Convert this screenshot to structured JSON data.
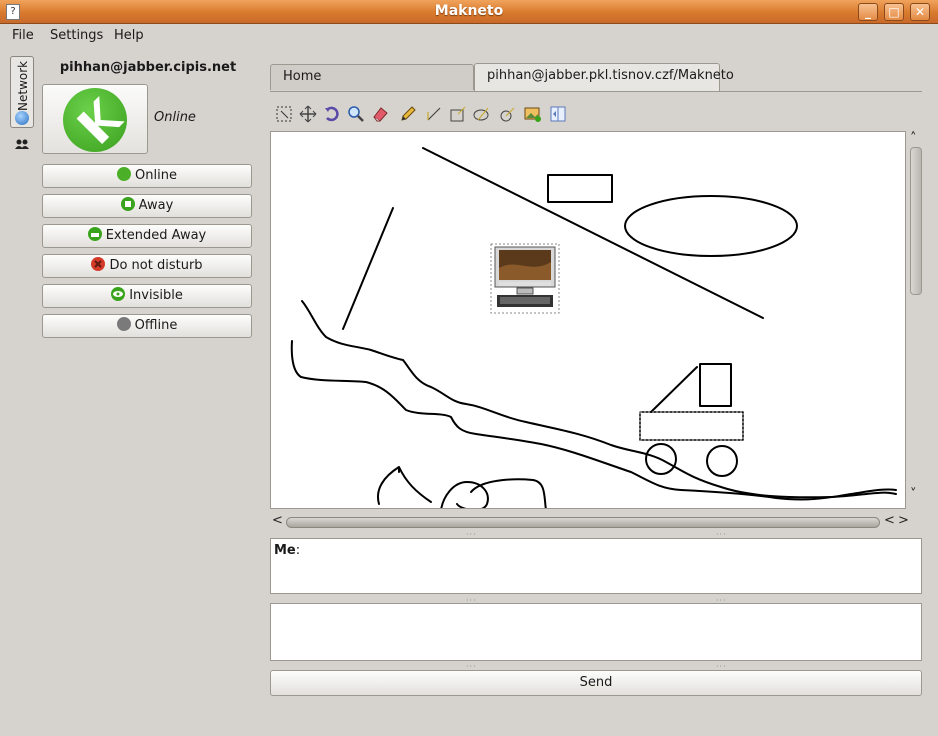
{
  "window": {
    "title": "Makneto"
  },
  "menu": [
    {
      "label": "File"
    },
    {
      "label": "Settings"
    },
    {
      "label": "Help"
    }
  ],
  "side_tabs": {
    "network_label": "Network"
  },
  "account": {
    "jid": "pihhan@jabber.cipis.net",
    "status_text": "Online"
  },
  "status_buttons": [
    {
      "label": "Online",
      "color": "#4caf28"
    },
    {
      "label": "Away",
      "color": "#3aa31c"
    },
    {
      "label": "Extended Away",
      "color": "#3aa31c"
    },
    {
      "label": "Do not disturb",
      "color": "#d43a2a"
    },
    {
      "label": "Invisible",
      "color": "#3aa31c"
    },
    {
      "label": "Offline",
      "color": "#7a7a7a"
    }
  ],
  "tabs": [
    {
      "label": "Home"
    },
    {
      "label": "pihhan@jabber.pkl.tisnov.czf/Makneto"
    }
  ],
  "toolbar": [
    {
      "icon": "select-icon"
    },
    {
      "icon": "move-icon"
    },
    {
      "icon": "rotate-icon"
    },
    {
      "icon": "zoom-icon"
    },
    {
      "icon": "eraser-icon"
    },
    {
      "icon": "pencil-icon"
    },
    {
      "icon": "line-icon"
    },
    {
      "icon": "rectangle-icon"
    },
    {
      "icon": "ellipse-icon"
    },
    {
      "icon": "circle-icon"
    },
    {
      "icon": "insert-image-icon"
    },
    {
      "icon": "flip-icon"
    }
  ],
  "chat": {
    "sender": "Me",
    "separator": ":",
    "message": ""
  },
  "send_button": {
    "label": "Send"
  }
}
